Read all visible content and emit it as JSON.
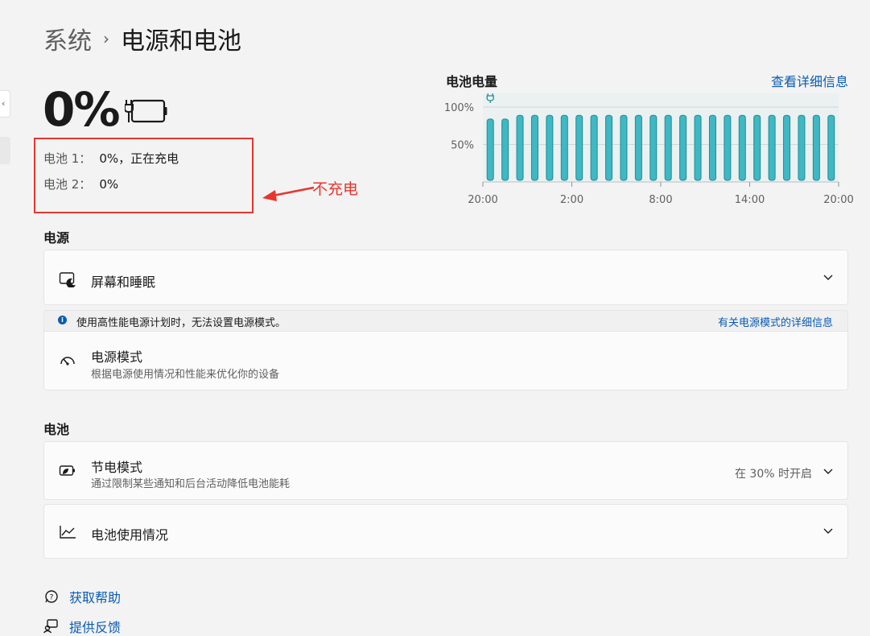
{
  "breadcrumb": {
    "parent": "系统",
    "separator": "›",
    "current": "电源和电池"
  },
  "battery": {
    "percent": "0%",
    "items": [
      {
        "label": "电池 1：",
        "value": "0%，正在充电"
      },
      {
        "label": "电池 2：",
        "value": "0%"
      }
    ]
  },
  "annotation": {
    "text": "不充电",
    "color": "#e8352d"
  },
  "chart": {
    "title": "电池电量",
    "link": "查看详细信息"
  },
  "chart_data": {
    "type": "bar",
    "ylim": [
      0,
      100
    ],
    "y_ticks": [
      "100%",
      "50%"
    ],
    "x_ticks": [
      "20:00",
      "2:00",
      "8:00",
      "14:00",
      "20:00"
    ],
    "values": [
      84,
      84,
      89,
      89,
      89,
      89,
      89,
      89,
      89,
      89,
      89,
      89,
      89,
      89,
      89,
      89,
      89,
      89,
      89,
      89,
      89,
      89,
      89,
      89
    ],
    "bar_color": "#3fb8c4",
    "grid": true
  },
  "power": {
    "section_label": "电源",
    "screen_sleep": {
      "title": "屏幕和睡眠"
    },
    "info": {
      "text": "使用高性能电源计划时，无法设置电源模式。",
      "link": "有关电源模式的详细信息"
    },
    "power_mode": {
      "title": "电源模式",
      "subtitle": "根据电源使用情况和性能来优化你的设备"
    }
  },
  "battery_section": {
    "section_label": "电池",
    "saver": {
      "title": "节电模式",
      "subtitle": "通过限制某些通知和后台活动降低电池能耗",
      "status": "在 30% 时开启"
    },
    "usage": {
      "title": "电池使用情况"
    }
  },
  "footer": {
    "help": "获取帮助",
    "feedback": "提供反馈"
  },
  "colors": {
    "accent": "#0a5bb5",
    "chart_bar": "#3fb8c4",
    "annotation": "#e8352d"
  }
}
